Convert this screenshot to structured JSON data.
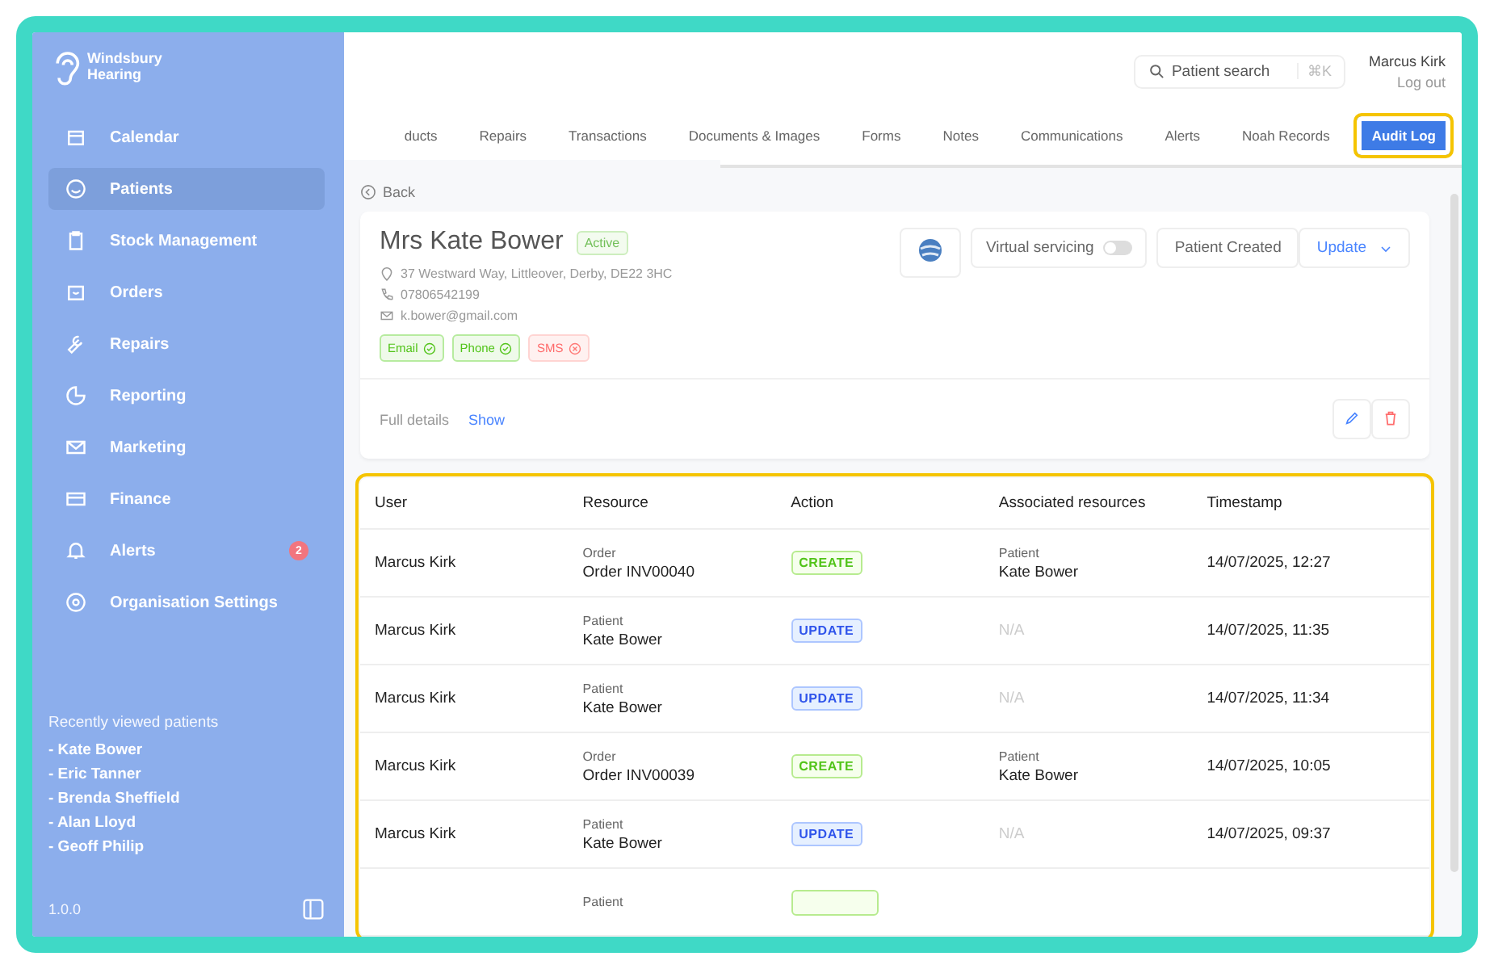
{
  "sidebar": {
    "logo": "Windsbury Hearing",
    "items": [
      {
        "label": "Calendar",
        "selected": false
      },
      {
        "label": "Patients",
        "selected": true
      },
      {
        "label": "Stock Management",
        "selected": false
      },
      {
        "label": "Orders",
        "selected": false
      },
      {
        "label": "Repairs",
        "selected": false
      },
      {
        "label": "Reporting",
        "selected": false
      },
      {
        "label": "Marketing",
        "selected": false
      },
      {
        "label": "Finance",
        "selected": false
      },
      {
        "label": "Alerts",
        "selected": false,
        "badge": "2"
      },
      {
        "label": "Organisation Settings",
        "selected": false
      }
    ],
    "recent_title": "Recently viewed patients",
    "recent": [
      "- Kate Bower",
      "- Eric Tanner",
      "- Brenda Sheffield",
      "- Alan Lloyd",
      "- Geoff Philip"
    ],
    "version": "1.0.0"
  },
  "header": {
    "search": {
      "placeholder": "Patient search",
      "shortcut": "⌘K"
    },
    "user": "Marcus Kirk",
    "logout": "Log out"
  },
  "tabs": [
    {
      "label": "ducts",
      "selected": false,
      "highlight": false
    },
    {
      "label": "Repairs",
      "selected": false,
      "highlight": false
    },
    {
      "label": "Transactions",
      "selected": false,
      "highlight": false
    },
    {
      "label": "Documents & Images",
      "selected": false,
      "highlight": false
    },
    {
      "label": "Forms",
      "selected": false,
      "highlight": false
    },
    {
      "label": "Notes",
      "selected": false,
      "highlight": false
    },
    {
      "label": "Communications",
      "selected": false,
      "highlight": false
    },
    {
      "label": "Alerts",
      "selected": false,
      "highlight": false
    },
    {
      "label": "Noah Records",
      "selected": false,
      "highlight": false
    },
    {
      "label": "Audit Log",
      "selected": true,
      "highlight": true
    }
  ],
  "back": "Back",
  "patient": {
    "name": "Mrs Kate Bower",
    "status": "Active",
    "address": "37 Westward Way, Littleover, Derby, DE22 3HC",
    "phone": "07806542199",
    "email": "k.bower@gmail.com",
    "consents": [
      {
        "label": "Email",
        "on": true
      },
      {
        "label": "Phone",
        "on": true
      },
      {
        "label": "SMS",
        "on": false
      }
    ],
    "virtual_servicing": {
      "label": "Virtual servicing",
      "on": false
    },
    "status_button": "Patient Created",
    "update_button": "Update",
    "full_details": "Full details",
    "show": "Show"
  },
  "table": {
    "highlight": true,
    "columns": [
      "User",
      "Resource",
      "Action",
      "Associated resources",
      "Timestamp"
    ],
    "rows": [
      {
        "user": "Marcus Kirk",
        "resource_type": "Order",
        "resource": "Order INV00040",
        "action": "CREATE",
        "kind": "create",
        "assoc_type": "Patient",
        "assoc": "Kate Bower",
        "timestamp": "14/07/2025, 12:27"
      },
      {
        "user": "Marcus Kirk",
        "resource_type": "Patient",
        "resource": "Kate Bower",
        "action": "UPDATE",
        "kind": "update",
        "assoc": "N/A",
        "timestamp": "14/07/2025, 11:35"
      },
      {
        "user": "Marcus Kirk",
        "resource_type": "Patient",
        "resource": "Kate Bower",
        "action": "UPDATE",
        "kind": "update",
        "assoc": "N/A",
        "timestamp": "14/07/2025, 11:34"
      },
      {
        "user": "Marcus Kirk",
        "resource_type": "Order",
        "resource": "Order INV00039",
        "action": "CREATE",
        "kind": "create",
        "assoc_type": "Patient",
        "assoc": "Kate Bower",
        "timestamp": "14/07/2025, 10:05"
      },
      {
        "user": "Marcus Kirk",
        "resource_type": "Patient",
        "resource": "Kate Bower",
        "action": "UPDATE",
        "kind": "update",
        "assoc": "N/A",
        "timestamp": "14/07/2025, 09:37"
      },
      {
        "resource_type": "Patient",
        "kind": "create"
      }
    ]
  }
}
